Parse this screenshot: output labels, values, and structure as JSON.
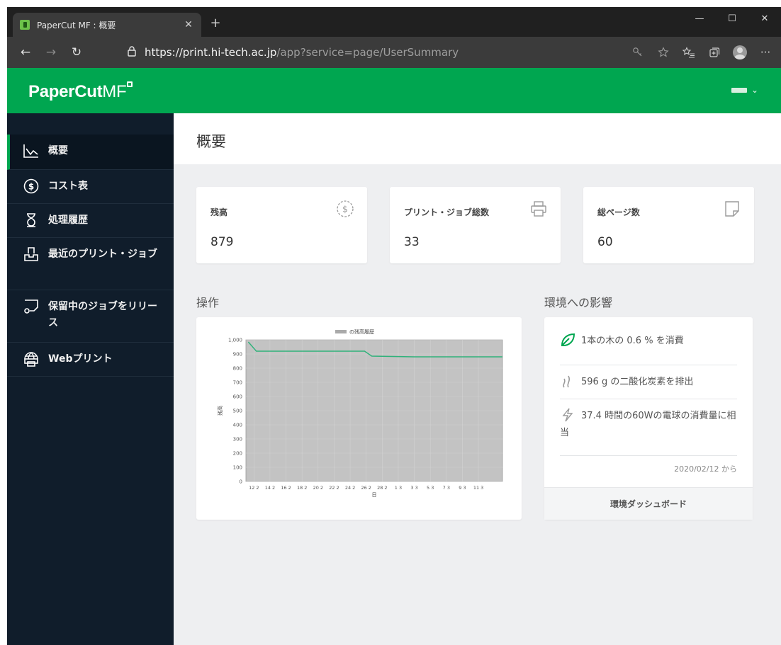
{
  "browser": {
    "tab_title": "PaperCut MF : 概要",
    "tab_close": "✕",
    "new_tab": "+",
    "url_host": "https://print.hi-tech.ac.jp",
    "url_path": "/app?service=page/UserSummary",
    "window_controls": {
      "minimize": "—",
      "maximize": "☐",
      "close": "✕"
    },
    "nav": {
      "back": "←",
      "forward": "→",
      "refresh": "↻"
    },
    "more": "···"
  },
  "header": {
    "logo_bold": "PaperCut",
    "logo_light": "MF",
    "user_chevron": "⌄"
  },
  "sidebar": {
    "items": [
      {
        "label": "概要",
        "icon": "chart-icon",
        "active": true
      },
      {
        "label": "コスト表",
        "icon": "dollar-circle-icon"
      },
      {
        "label": "処理履歴",
        "icon": "hourglass-icon"
      },
      {
        "label": "最近のプリント・ジョブ",
        "icon": "inbox-icon"
      },
      {
        "label": "保留中のジョブをリリース",
        "icon": "release-icon"
      },
      {
        "label": "Webプリント",
        "icon": "globe-printer-icon"
      }
    ]
  },
  "page": {
    "title": "概要"
  },
  "stats": [
    {
      "label": "残高",
      "value": "879",
      "icon": "dollar-dashed-icon"
    },
    {
      "label": "プリント・ジョブ総数",
      "value": "33",
      "icon": "printer-icon"
    },
    {
      "label": "総ページ数",
      "value": "60",
      "icon": "page-icon"
    }
  ],
  "sections": {
    "operations": "操作",
    "environment": "環境への影響"
  },
  "chart_data": {
    "type": "line",
    "title": "の残高履歴",
    "xlabel": "日",
    "ylabel": "残高",
    "ylim": [
      0,
      1000
    ],
    "y_ticks": [
      "0",
      "100",
      "200",
      "300",
      "400",
      "500",
      "600",
      "700",
      "800",
      "900",
      "1,000"
    ],
    "x_ticks": [
      "12 2",
      "14 2",
      "16 2",
      "18 2",
      "20 2",
      "22 2",
      "24 2",
      "26 2",
      "28 2",
      "1 3",
      "3 3",
      "5 3",
      "7 3",
      "9 3",
      "11 3"
    ],
    "x_range": [
      11,
      43
    ],
    "series": [
      {
        "x": [
          11.3,
          12.3,
          25.8,
          26.7,
          32,
          43
        ],
        "y": [
          985,
          920,
          920,
          885,
          880,
          880
        ]
      }
    ],
    "grid": true,
    "line_color": "#2fb27a",
    "plot_bg": "#c3c3c3"
  },
  "environment": {
    "tree": "1本の木の 0.6 % を消費",
    "co2": "596 g の二酸化炭素を排出",
    "bulb": "37.4 時間の60Wの電球の消費量に相当",
    "since": "2020/02/12 から",
    "dashboard_link": "環境ダッシュボード"
  },
  "colors": {
    "brand_green": "#00a650",
    "sidebar_bg": "#101d2b"
  }
}
